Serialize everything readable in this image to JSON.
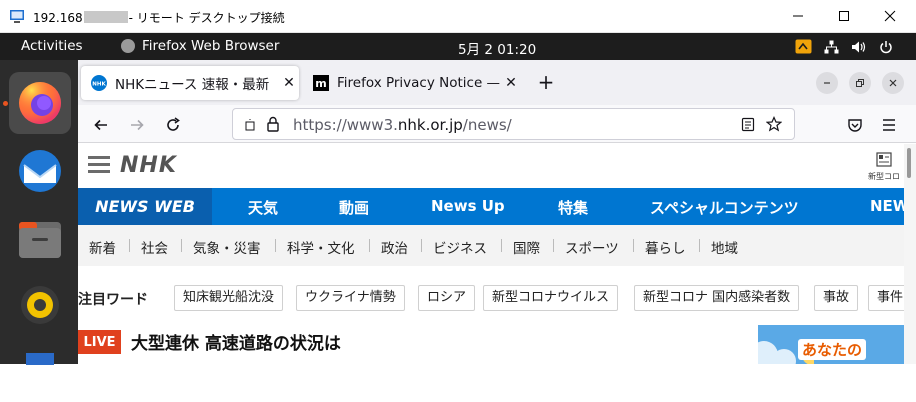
{
  "rdp": {
    "title_prefix": "192.168",
    "title_suffix": "- リモート デスクトップ接続"
  },
  "topbar": {
    "activities": "Activities",
    "app_name": "Firefox Web Browser",
    "clock": "5月 2  01:20"
  },
  "dock": {
    "items": [
      "firefox-icon",
      "thunderbird-icon",
      "files-icon",
      "rhythmbox-icon",
      "writer-icon"
    ]
  },
  "browser": {
    "tabs": [
      {
        "label": "NHKニュース 速報・最新",
        "favicon": "nhk-favicon"
      },
      {
        "label": "Firefox Privacy Notice —",
        "favicon": "mozilla-favicon"
      }
    ],
    "url_prefix": "https://www3.",
    "url_domain": "nhk.or.jp",
    "url_path": "/news/"
  },
  "page": {
    "logo": "NHK",
    "corona_link": "新型コロ",
    "blue_nav": [
      "NEWS WEB",
      "天気",
      "動画",
      "News Up",
      "特集",
      "スペシャルコンテンツ",
      "NEW"
    ],
    "gray_nav": [
      "新着",
      "社会",
      "気象・災害",
      "科学・文化",
      "政治",
      "ビジネス",
      "国際",
      "スポーツ",
      "暮らし",
      "地域"
    ],
    "keywords_label": "注目ワード",
    "keywords": [
      "知床観光船沈没",
      "ウクライナ情勢",
      "ロシア",
      "新型コロナウイルス",
      "新型コロナ 国内感染者数",
      "事故",
      "事件"
    ],
    "live_badge": "LIVE",
    "headline": "大型連休 高速道路の状況は",
    "banner_text": "あなたの"
  },
  "colors": {
    "nhk_blue": "#0076d1",
    "newsweb_blue": "#0a5fae",
    "live_red": "#e0411e",
    "topbar_bg": "#1d1d1d",
    "dock_bg": "#2c2c2c"
  }
}
